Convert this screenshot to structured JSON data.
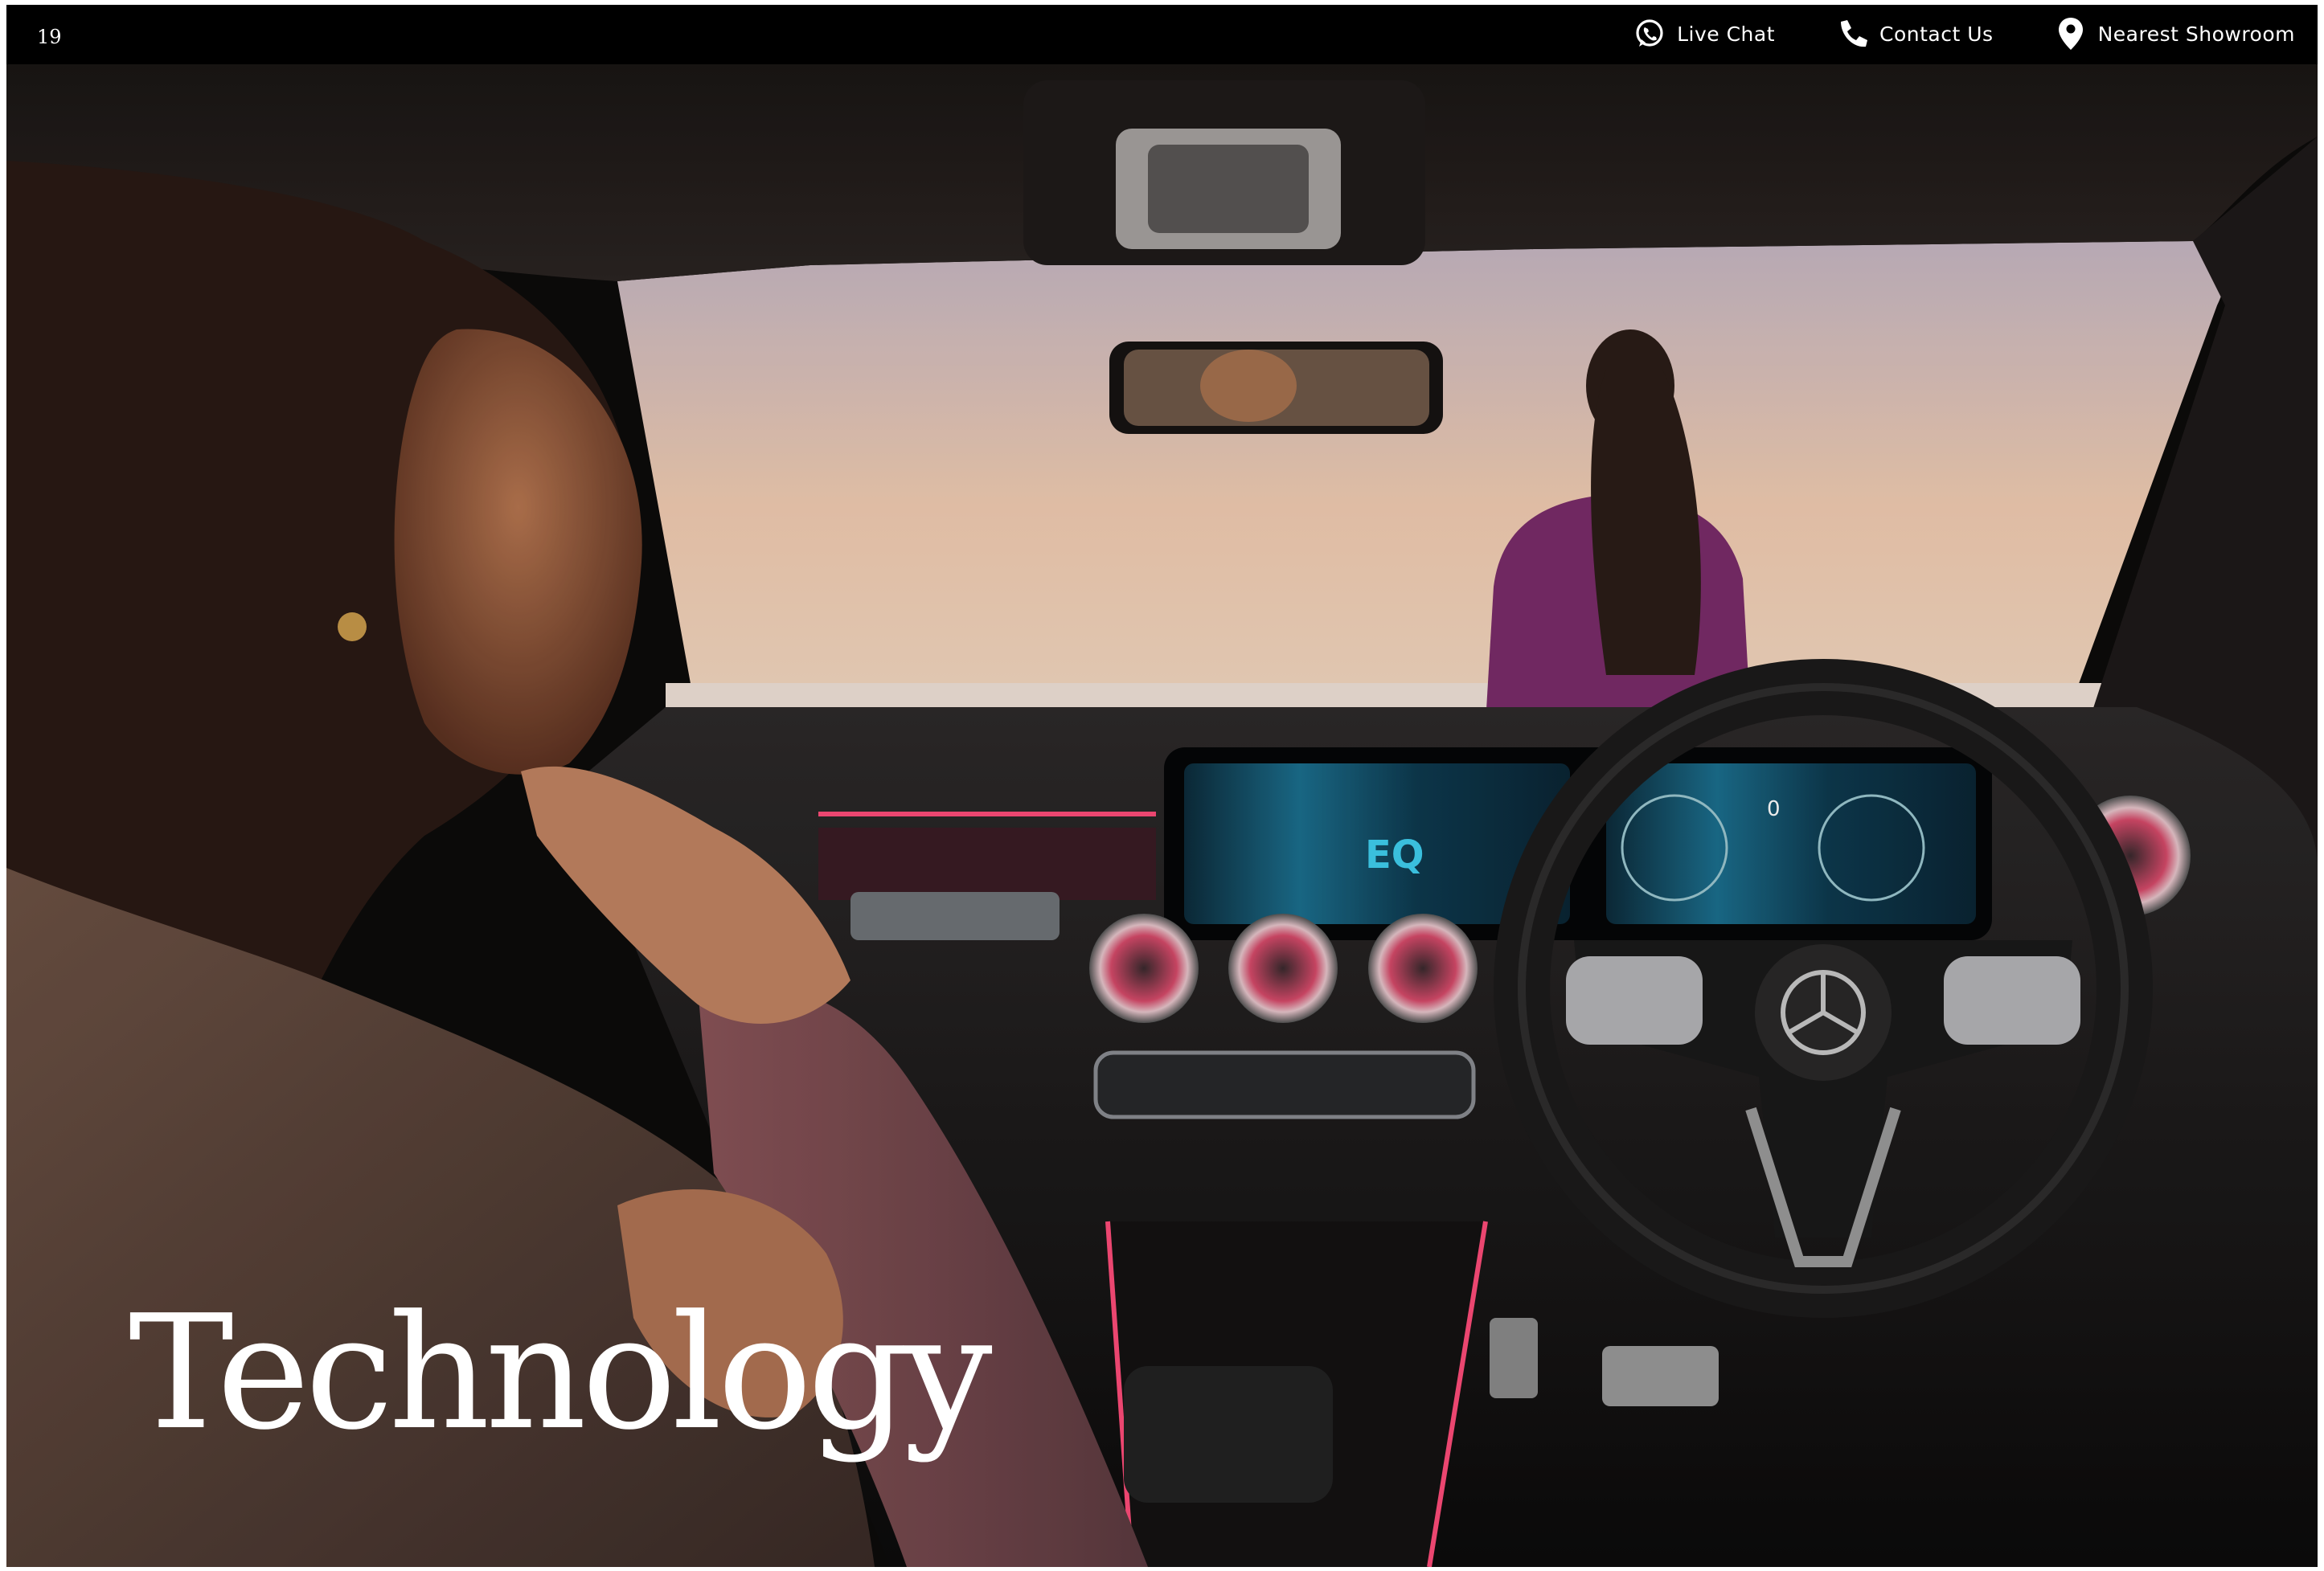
{
  "page": {
    "number": "19",
    "title": "Technology"
  },
  "header": {
    "links": [
      {
        "label": "Live Chat",
        "icon": "whatsapp-icon"
      },
      {
        "label": "Contact Us",
        "icon": "phone-icon"
      },
      {
        "label": "Nearest Showroom",
        "icon": "map-pin-icon"
      }
    ]
  },
  "colors": {
    "background": "#000000",
    "text": "#ffffff",
    "sky_top": "#c7b8c6",
    "sky_bottom": "#f3c9a8",
    "ambient_light": "#ff4d7a",
    "screen_glow": "#2fb8d8"
  },
  "photo": {
    "screen_badge": "EQ",
    "speedometer_readout": "0"
  }
}
